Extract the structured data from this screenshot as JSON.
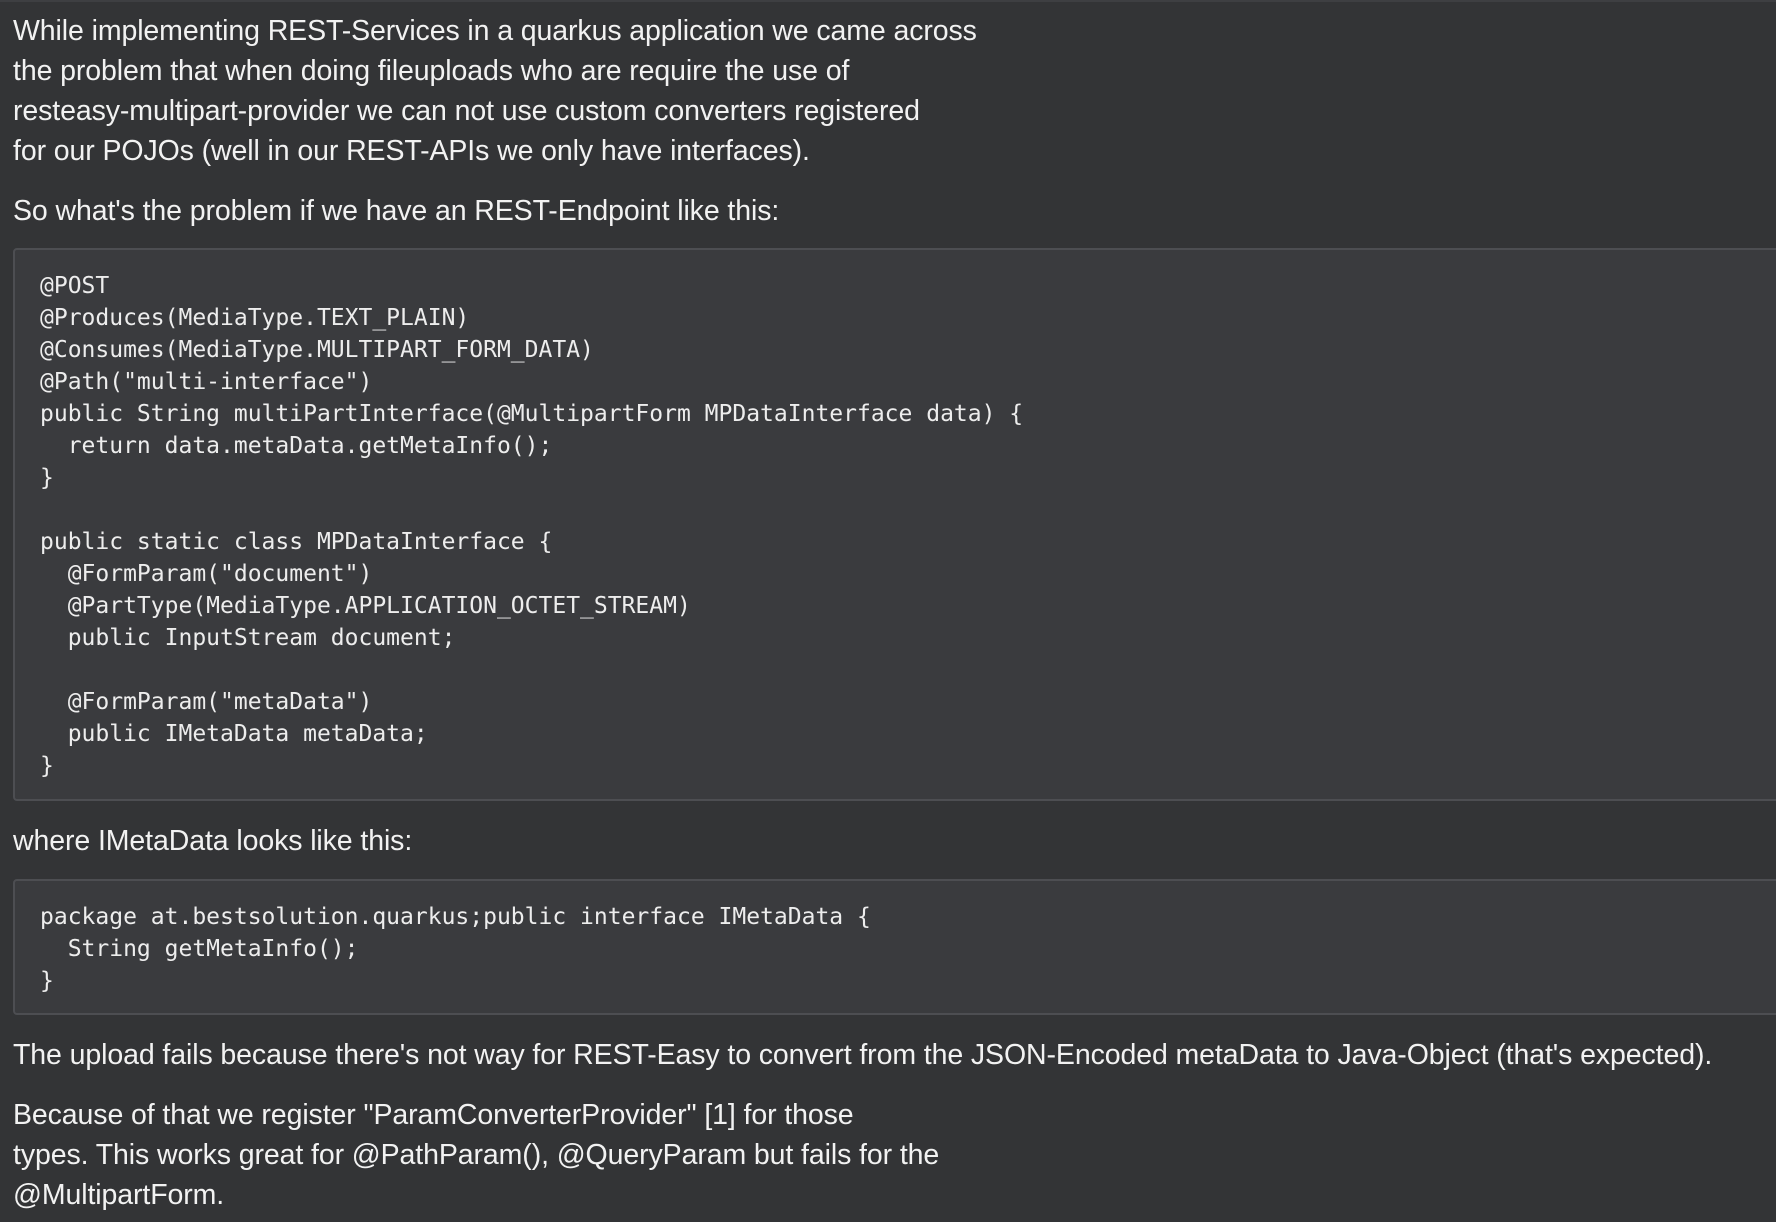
{
  "paragraphs": {
    "intro_lines": [
      "While implementing REST-Services in a quarkus application we came across",
      "the problem that when doing fileuploads who are require the use of",
      "resteasy-multipart-provider we can not use custom converters registered",
      "for our POJOs (well in our REST-APIs we only have interfaces)."
    ],
    "problem_intro": "So what's the problem if we have an REST-Endpoint like this:",
    "imetadata_intro": "where IMetaData looks like this:",
    "upload_fails": "The upload fails because there's not way for REST-Easy to convert from the JSON-Encoded metaData to Java-Object (that's expected).",
    "because_lines": [
      "Because of that we register \"ParamConverterProvider\" [1] for those",
      "types. This works great for @PathParam(), @QueryParam but fails for the",
      "@MultipartForm."
    ]
  },
  "code_blocks": {
    "endpoint": "@POST\n@Produces(MediaType.TEXT_PLAIN)\n@Consumes(MediaType.MULTIPART_FORM_DATA)\n@Path(\"multi-interface\")\npublic String multiPartInterface(@MultipartForm MPDataInterface data) {\n  return data.metaData.getMetaInfo();\n}\n\npublic static class MPDataInterface {\n  @FormParam(\"document\")\n  @PartType(MediaType.APPLICATION_OCTET_STREAM)\n  public InputStream document;\n\n  @FormParam(\"metaData\")\n  public IMetaData metaData;\n}",
    "imetadata": "package at.bestsolution.quarkus;public interface IMetaData {\n  String getMetaInfo();\n}"
  }
}
